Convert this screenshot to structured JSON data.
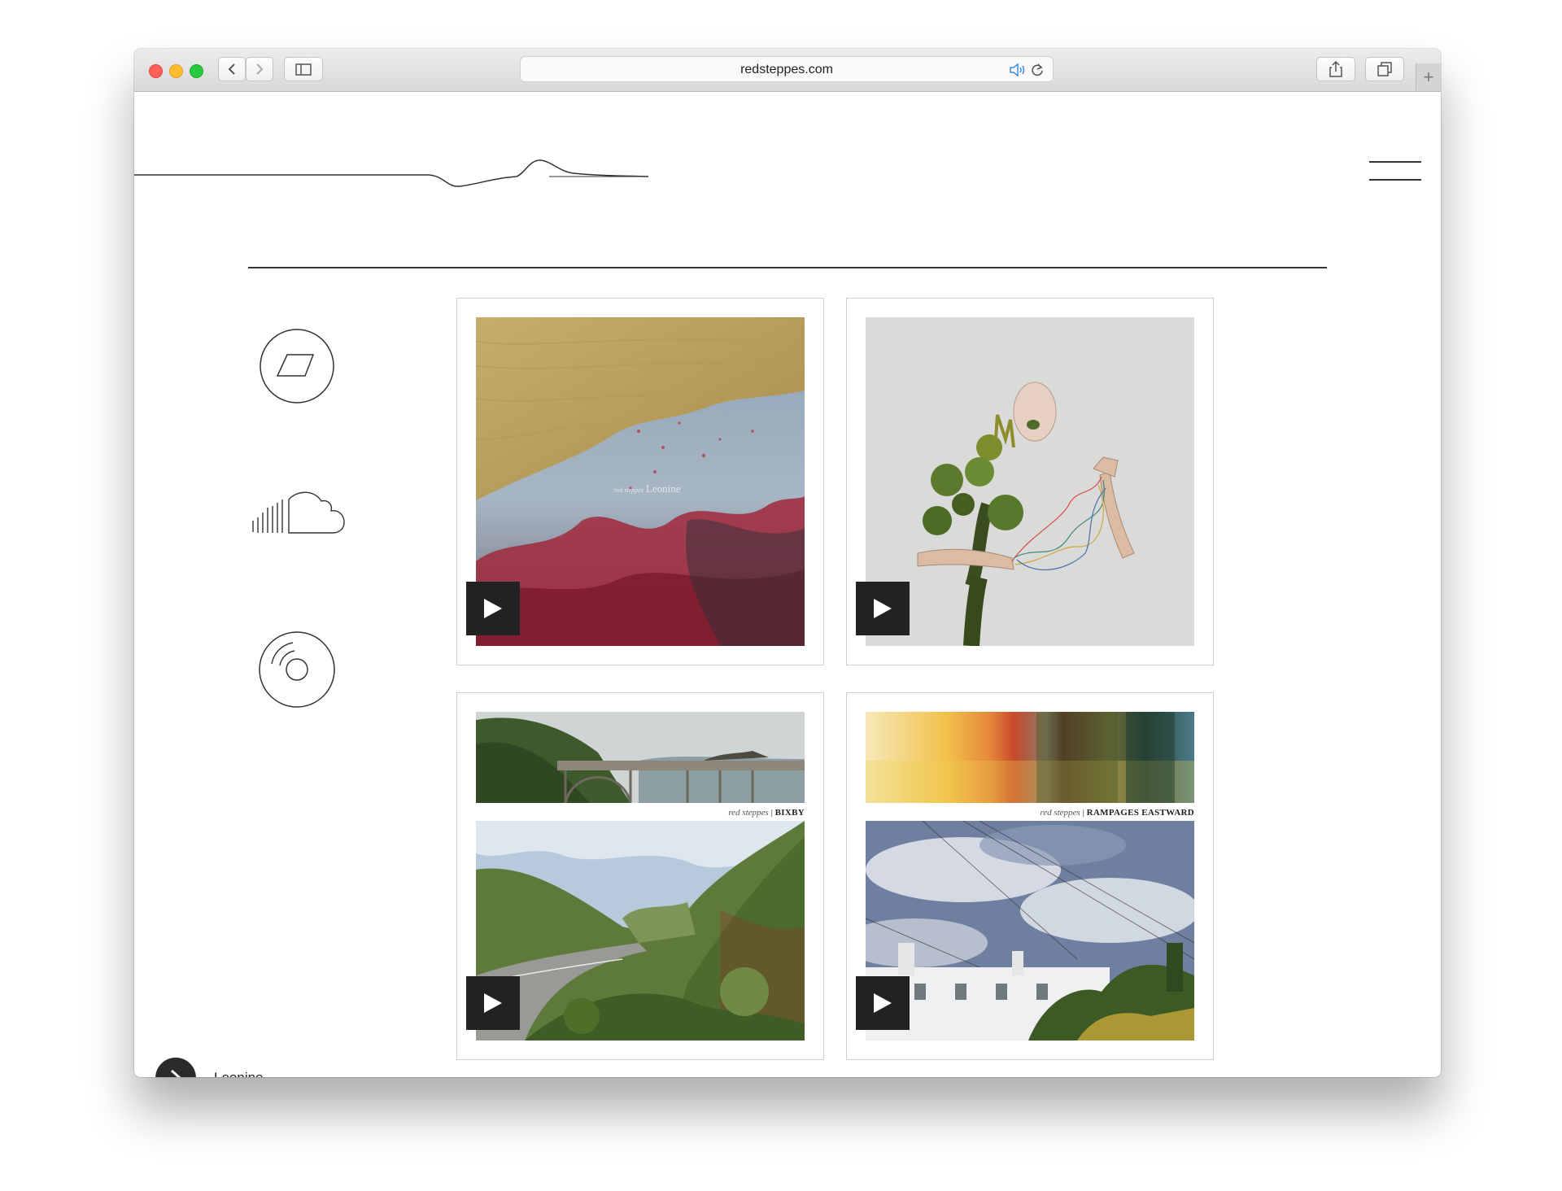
{
  "browser": {
    "url": "redsteppes.com",
    "colors": {
      "close": "#fe5f57",
      "minimize": "#febc2e",
      "zoom": "#28c840",
      "audio": "#3b8de4"
    }
  },
  "header": {
    "logo_icon": "line-wave-logo",
    "menu_icon": "hamburger-icon"
  },
  "social": [
    {
      "icon": "bandcamp-icon"
    },
    {
      "icon": "soundcloud-icon"
    },
    {
      "icon": "vinyl-record-icon"
    }
  ],
  "albums": [
    {
      "cover_artist": "red steppes",
      "cover_title": "Leonine",
      "play_icon": "play-icon"
    },
    {
      "cover_artist": "",
      "cover_title": "",
      "play_icon": "play-icon"
    },
    {
      "cover_artist": "red steppes",
      "cover_title": "BIXBY",
      "play_icon": "play-icon"
    },
    {
      "cover_artist": "red steppes",
      "cover_title": "RAMPAGES EASTWARD",
      "play_icon": "play-icon"
    }
  ],
  "player": {
    "now_playing": "Leonine",
    "play_icon": "play-circle-icon"
  }
}
